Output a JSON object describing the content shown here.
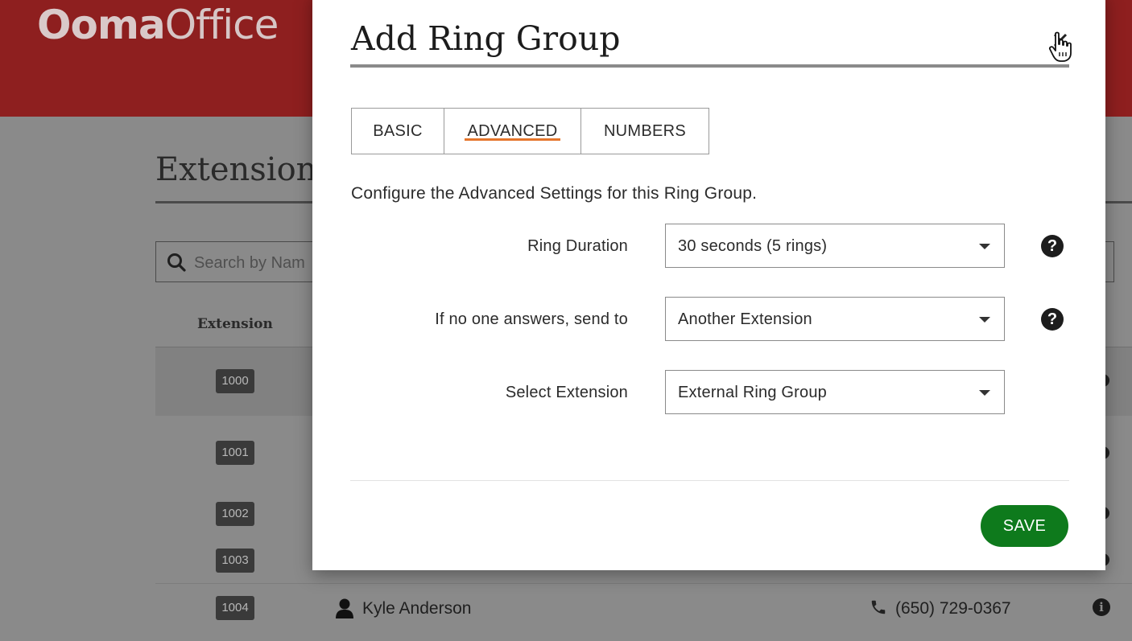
{
  "background": {
    "brand": {
      "logo_part1": "Ooma",
      "logo_part2": "Office"
    },
    "page_title": "Extension",
    "search_placeholder": "Search by Nam",
    "table": {
      "column_extension": "Extension",
      "rows": [
        {
          "extension": "1000"
        },
        {
          "extension": "1001"
        },
        {
          "extension": "1002"
        },
        {
          "extension": "1003"
        },
        {
          "extension": "1004",
          "name": "Kyle Anderson",
          "phone": "(650) 729-0367"
        }
      ]
    }
  },
  "modal": {
    "title": "Add Ring Group",
    "tabs": [
      {
        "label": "BASIC",
        "active": false
      },
      {
        "label": "ADVANCED",
        "active": true
      },
      {
        "label": "NUMBERS",
        "active": false
      }
    ],
    "intro": "Configure the Advanced Settings for this Ring Group.",
    "fields": [
      {
        "label": "Ring Duration",
        "value": "30 seconds (5 rings)",
        "help": true
      },
      {
        "label": "If no one answers, send to",
        "value": "Another Extension",
        "help": true
      },
      {
        "label": "Select Extension",
        "value": "External Ring Group",
        "help": false
      }
    ],
    "save_label": "SAVE"
  },
  "colors": {
    "header_red": "#8e1f1f",
    "accent_orange": "#e5752b",
    "save_green": "#0e7a1c"
  }
}
